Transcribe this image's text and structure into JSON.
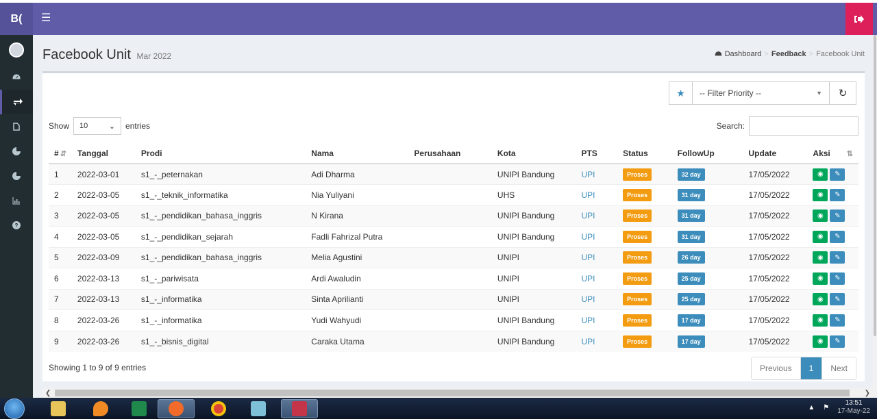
{
  "brand": "B(",
  "header": {
    "title": "Facebook Unit",
    "subtitle": "Mar 2022"
  },
  "breadcrumb": {
    "home": "Dashboard",
    "mid": "Feedback",
    "current": "Facebook Unit"
  },
  "filter": {
    "placeholder": "-- Filter Priority --"
  },
  "table_controls": {
    "show_label": "Show",
    "length_value": "10",
    "entries_label": "entries",
    "search_label": "Search:"
  },
  "columns": [
    "#",
    "Tanggal",
    "Prodi",
    "Nama",
    "Perusahaan",
    "Kota",
    "PTS",
    "Status",
    "FollowUp",
    "Update",
    "Aksi"
  ],
  "rows": [
    {
      "no": "1",
      "tanggal": "2022-03-01",
      "prodi": "s1_-_peternakan",
      "nama": "Adi Dharma",
      "perusahaan": "",
      "kota": "UNIPI Bandung",
      "pts": "UPI",
      "status": "Proses",
      "followup": "32 day",
      "update": "17/05/2022"
    },
    {
      "no": "2",
      "tanggal": "2022-03-05",
      "prodi": "s1_-_teknik_informatika",
      "nama": "Nia Yuliyani",
      "perusahaan": "",
      "kota": "UHS",
      "pts": "UPI",
      "status": "Proses",
      "followup": "31 day",
      "update": "17/05/2022"
    },
    {
      "no": "3",
      "tanggal": "2022-03-05",
      "prodi": "s1_-_pendidikan_bahasa_inggris",
      "nama": "N Kirana",
      "perusahaan": "",
      "kota": "UNIPI Bandung",
      "pts": "UPI",
      "status": "Proses",
      "followup": "31 day",
      "update": "17/05/2022"
    },
    {
      "no": "4",
      "tanggal": "2022-03-05",
      "prodi": "s1_-_pendidikan_sejarah",
      "nama": "Fadli Fahrizal Putra",
      "perusahaan": "",
      "kota": "UNIPI Bandung",
      "pts": "UPI",
      "status": "Proses",
      "followup": "31 day",
      "update": "17/05/2022"
    },
    {
      "no": "5",
      "tanggal": "2022-03-09",
      "prodi": "s1_-_pendidikan_bahasa_inggris",
      "nama": "Melia Agustini",
      "perusahaan": "",
      "kota": "UNIPI",
      "pts": "UPI",
      "status": "Proses",
      "followup": "26 day",
      "update": "17/05/2022"
    },
    {
      "no": "6",
      "tanggal": "2022-03-13",
      "prodi": "s1_-_pariwisata",
      "nama": "Ardi Awaludin",
      "perusahaan": "",
      "kota": "UNIPI",
      "pts": "UPI",
      "status": "Proses",
      "followup": "25 day",
      "update": "17/05/2022"
    },
    {
      "no": "7",
      "tanggal": "2022-03-13",
      "prodi": "s1_-_informatika",
      "nama": "Sinta Aprilianti",
      "perusahaan": "",
      "kota": "UNIPI",
      "pts": "UPI",
      "status": "Proses",
      "followup": "25 day",
      "update": "17/05/2022"
    },
    {
      "no": "8",
      "tanggal": "2022-03-26",
      "prodi": "s1_-_informatika",
      "nama": "Yudi Wahyudi",
      "perusahaan": "",
      "kota": "UNIPI Bandung",
      "pts": "UPI",
      "status": "Proses",
      "followup": "17 day",
      "update": "17/05/2022"
    },
    {
      "no": "9",
      "tanggal": "2022-03-26",
      "prodi": "s1_-_bisnis_digital",
      "nama": "Caraka Utama",
      "perusahaan": "",
      "kota": "UNIPI Bandung",
      "pts": "UPI",
      "status": "Proses",
      "followup": "17 day",
      "update": "17/05/2022"
    }
  ],
  "footer": {
    "info": "Showing 1 to 9 of 9 entries",
    "prev": "Previous",
    "page": "1",
    "next": "Next"
  },
  "taskbar": {
    "time": "13:51",
    "date": "17-May-22"
  },
  "colors": {
    "topbar": "#605ca8",
    "sidebar": "#222d32",
    "logout": "#dd1f5a",
    "status": "#f39c12",
    "followup": "#3c8dbc",
    "view": "#00a65a"
  }
}
